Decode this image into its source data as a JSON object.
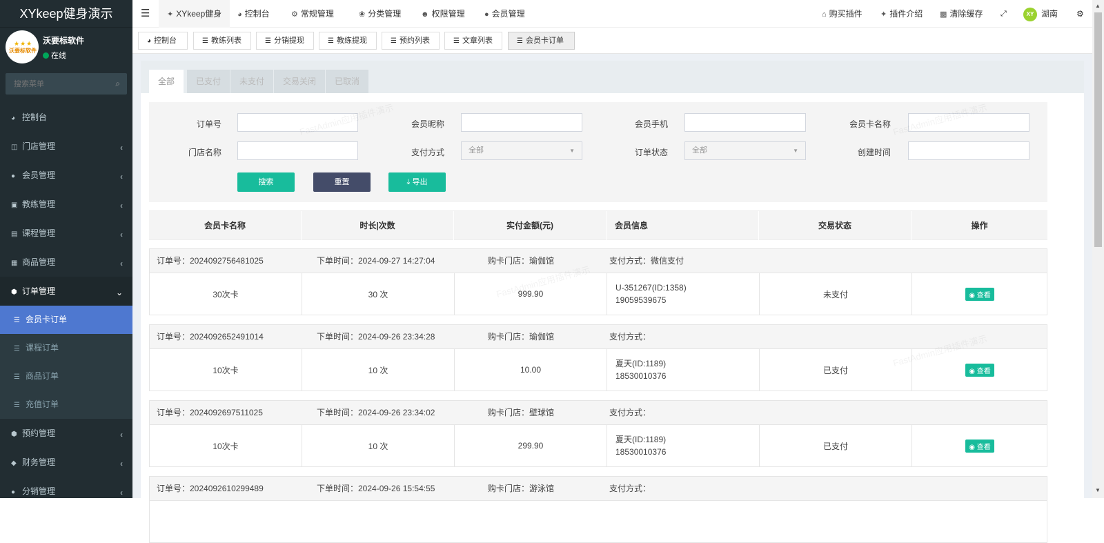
{
  "app": {
    "title": "XYkeep健身演示"
  },
  "user": {
    "name": "沃要标软件",
    "status": "在线",
    "avatar_text": "沃要标软件"
  },
  "search": {
    "placeholder": "搜索菜单"
  },
  "sidebar": {
    "items": [
      {
        "label": "控制台",
        "icon": "dashboard-icon"
      },
      {
        "label": "门店管理",
        "icon": "store-icon"
      },
      {
        "label": "会员管理",
        "icon": "user-icon"
      },
      {
        "label": "教练管理",
        "icon": "coach-icon"
      },
      {
        "label": "课程管理",
        "icon": "course-icon"
      },
      {
        "label": "商品管理",
        "icon": "goods-icon"
      },
      {
        "label": "订单管理",
        "icon": "order-icon"
      }
    ],
    "sub_items": [
      {
        "label": "会员卡订单"
      },
      {
        "label": "课程订单"
      },
      {
        "label": "商品订单"
      },
      {
        "label": "充值订单"
      }
    ],
    "items_after": [
      {
        "label": "预约管理",
        "icon": "booking-icon"
      },
      {
        "label": "财务管理",
        "icon": "finance-icon"
      },
      {
        "label": "分销管理",
        "icon": "distribution-icon"
      }
    ]
  },
  "topnav": {
    "items": [
      "XYkeep健身",
      "控制台",
      "常规管理",
      "分类管理",
      "权限管理",
      "会员管理"
    ],
    "right": [
      "购买插件",
      "插件介绍",
      "清除缓存"
    ],
    "region": "湖南"
  },
  "tabs": [
    "控制台",
    "教练列表",
    "分销提现",
    "教练提现",
    "预约列表",
    "文章列表",
    "会员卡订单"
  ],
  "status_tabs": [
    "全部",
    "已支付",
    "未支付",
    "交易关闭",
    "已取消"
  ],
  "filter": {
    "order_no": "订单号",
    "nickname": "会员昵称",
    "phone": "会员手机",
    "card_name": "会员卡名称",
    "store_name": "门店名称",
    "pay_method": "支付方式",
    "pay_method_value": "全部",
    "order_status": "订单状态",
    "order_status_value": "全部",
    "created": "创建时间",
    "search_btn": "搜索",
    "reset_btn": "重置",
    "export_btn": "导出"
  },
  "table": {
    "headers": [
      "会员卡名称",
      "时长|次数",
      "实付金额(元)",
      "会员信息",
      "交易状态",
      "操作"
    ],
    "view_label": "查看",
    "orders": [
      {
        "order_no": "订单号：2024092756481025",
        "time": "下单时间：2024-09-27 14:27:04",
        "store": "购卡门店：瑜伽馆",
        "pay": "支付方式：微信支付",
        "card": "30次卡",
        "count": "30 次",
        "amount": "999.90",
        "member": "U-351267(ID:1358)",
        "phone": "19059539675",
        "status": "未支付"
      },
      {
        "order_no": "订单号：2024092652491014",
        "time": "下单时间：2024-09-26 23:34:28",
        "store": "购卡门店：瑜伽馆",
        "pay": "支付方式：",
        "card": "10次卡",
        "count": "10 次",
        "amount": "10.00",
        "member": "夏天(ID:1189)",
        "phone": "18530010376",
        "status": "已支付"
      },
      {
        "order_no": "订单号：2024092697511025",
        "time": "下单时间：2024-09-26 23:34:02",
        "store": "购卡门店：壁球馆",
        "pay": "支付方式：",
        "card": "10次卡",
        "count": "10 次",
        "amount": "299.90",
        "member": "夏天(ID:1189)",
        "phone": "18530010376",
        "status": "已支付"
      },
      {
        "order_no": "订单号：2024092610299489",
        "time": "下单时间：2024-09-26 15:54:55",
        "store": "购卡门店：游泳馆",
        "pay": "支付方式：",
        "card": "",
        "count": "",
        "amount": "",
        "member": "",
        "phone": "",
        "status": ""
      }
    ]
  },
  "watermark": "FastAdmin应用插件演示",
  "colors": {
    "sidebar": "#222d32",
    "active": "#4e78d0",
    "primary": "#18bc9c",
    "dark": "#444c69"
  }
}
